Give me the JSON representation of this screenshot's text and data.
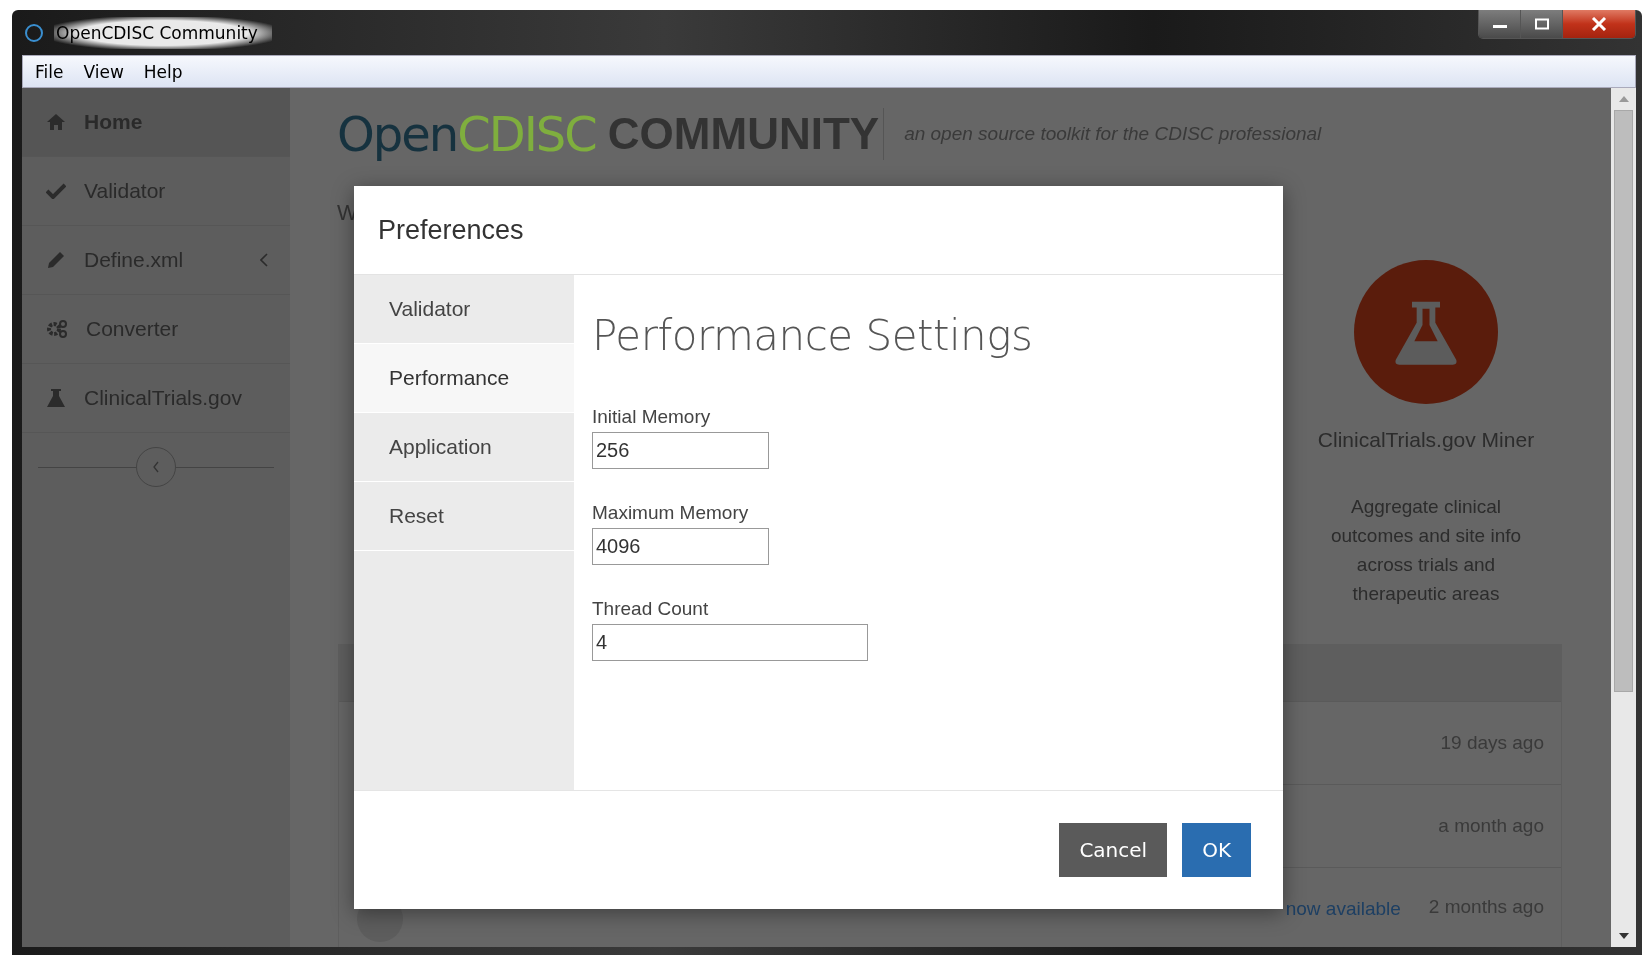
{
  "window": {
    "title": "OpenCDISC Community"
  },
  "menu": [
    "File",
    "View",
    "Help"
  ],
  "sidebar": {
    "items": [
      {
        "label": "Home",
        "selected": true,
        "submenu": false
      },
      {
        "label": "Validator",
        "selected": false,
        "submenu": false
      },
      {
        "label": "Define.xml",
        "selected": false,
        "submenu": true
      },
      {
        "label": "Converter",
        "selected": false,
        "submenu": false
      },
      {
        "label": "ClinicalTrials.gov",
        "selected": false,
        "submenu": false
      }
    ]
  },
  "header": {
    "logo_open": "Open",
    "logo_cdisc": "CDISC",
    "logo_community": "COMMUNITY",
    "tagline": "an open source toolkit for the CDISC professional"
  },
  "main": {
    "heading_fragment": "W"
  },
  "feature": {
    "title": "ClinicalTrials.gov Miner",
    "description": "Aggregate clinical outcomes and site info across trials and therapeutic areas"
  },
  "news": {
    "rows": [
      {
        "time": "19 days ago"
      },
      {
        "time": "a month ago"
      },
      {
        "link": "now available",
        "time": "2 months ago"
      }
    ]
  },
  "dialog": {
    "title": "Preferences",
    "nav": [
      {
        "label": "Validator",
        "selected": false
      },
      {
        "label": "Performance",
        "selected": true
      },
      {
        "label": "Application",
        "selected": false
      },
      {
        "label": "Reset",
        "selected": false
      }
    ],
    "heading": "Performance Settings",
    "fields": [
      {
        "label": "Initial Memory",
        "value": "256"
      },
      {
        "label": "Maximum Memory",
        "value": "4096"
      },
      {
        "label": "Thread Count",
        "value": "4"
      }
    ],
    "buttons": [
      {
        "label": "Cancel",
        "kind": "secondary"
      },
      {
        "label": "OK",
        "kind": "primary"
      }
    ]
  }
}
